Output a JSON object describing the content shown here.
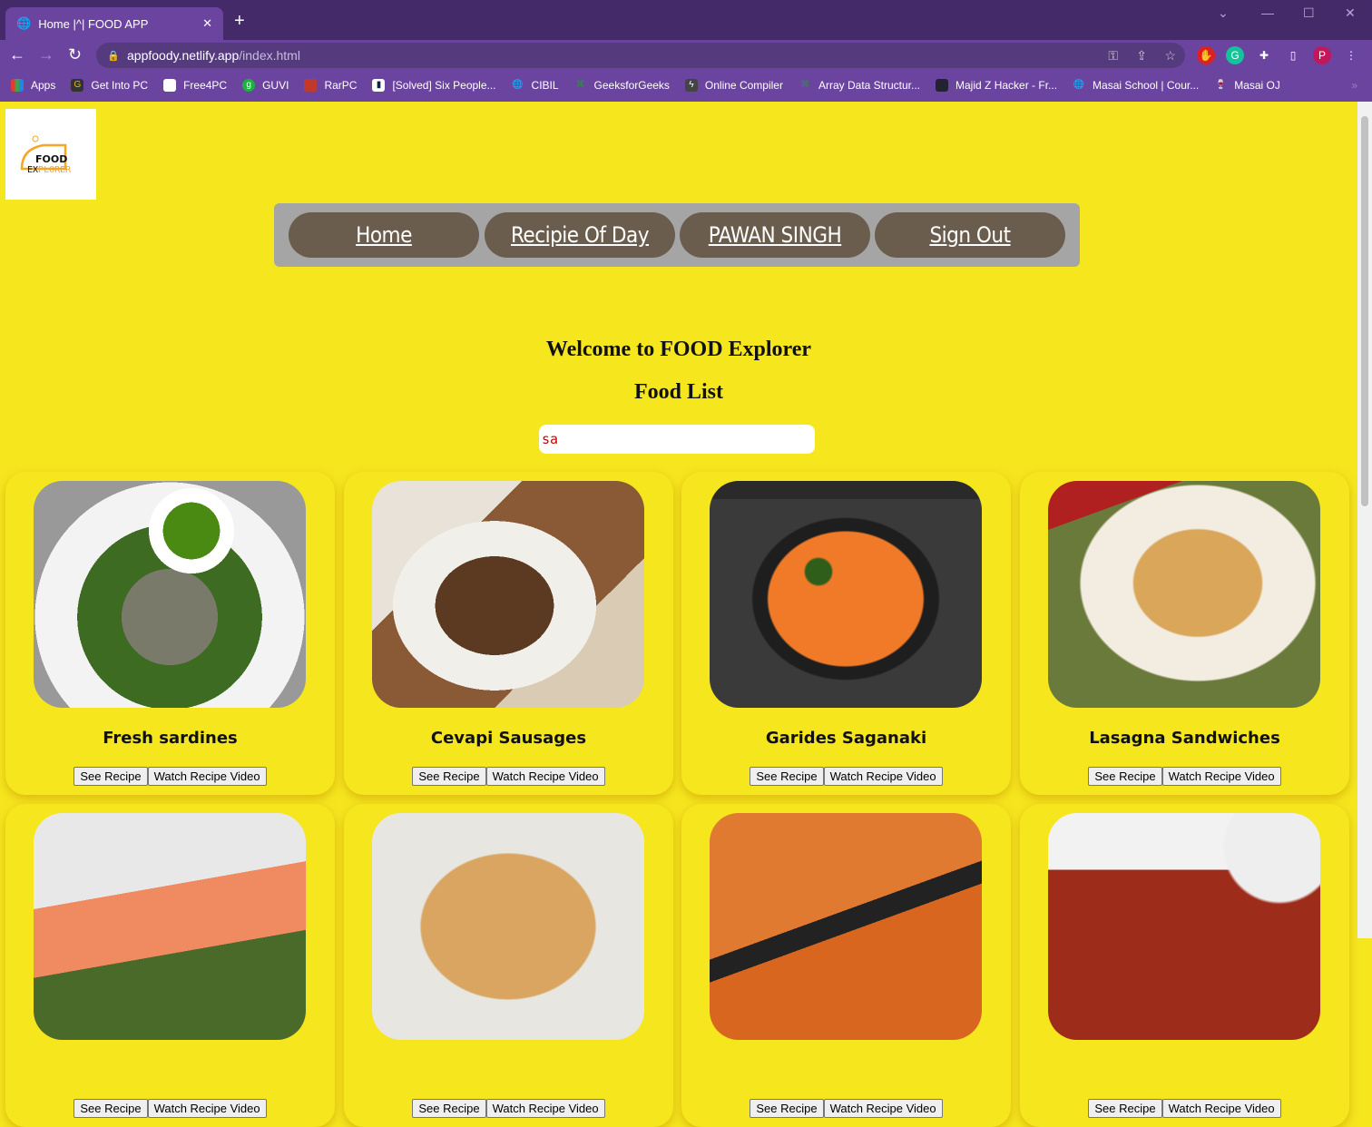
{
  "browser": {
    "tab_title": "Home |^| FOOD APP",
    "url_host": "appfoody.netlify.app",
    "url_path": "/index.html",
    "profile_initial": "P",
    "bookmarks": [
      "Apps",
      "Get Into PC",
      "Free4PC",
      "GUVI",
      "RarPC",
      "[Solved] Six People...",
      "CIBIL",
      "GeeksforGeeks",
      "Online Compiler",
      "Array Data Structur...",
      "Majid Z Hacker - Fr...",
      "Masai School | Cour...",
      "Masai OJ"
    ]
  },
  "logo": {
    "line1": "FOOD",
    "line2": "EXPLORER"
  },
  "nav": {
    "items": [
      "Home",
      "Recipie Of Day",
      "PAWAN SINGH",
      "Sign Out"
    ]
  },
  "main": {
    "welcome": "Welcome to FOOD Explorer",
    "list_title": "Food List",
    "search_value": "sa"
  },
  "card_buttons": {
    "recipe": "See Recipe",
    "video": "Watch Recipe Video"
  },
  "foods": [
    {
      "name": "Fresh sardines"
    },
    {
      "name": "Cevapi Sausages"
    },
    {
      "name": "Garides Saganaki"
    },
    {
      "name": "Lasagna Sandwiches"
    },
    {
      "name": ""
    },
    {
      "name": ""
    },
    {
      "name": ""
    },
    {
      "name": ""
    }
  ]
}
